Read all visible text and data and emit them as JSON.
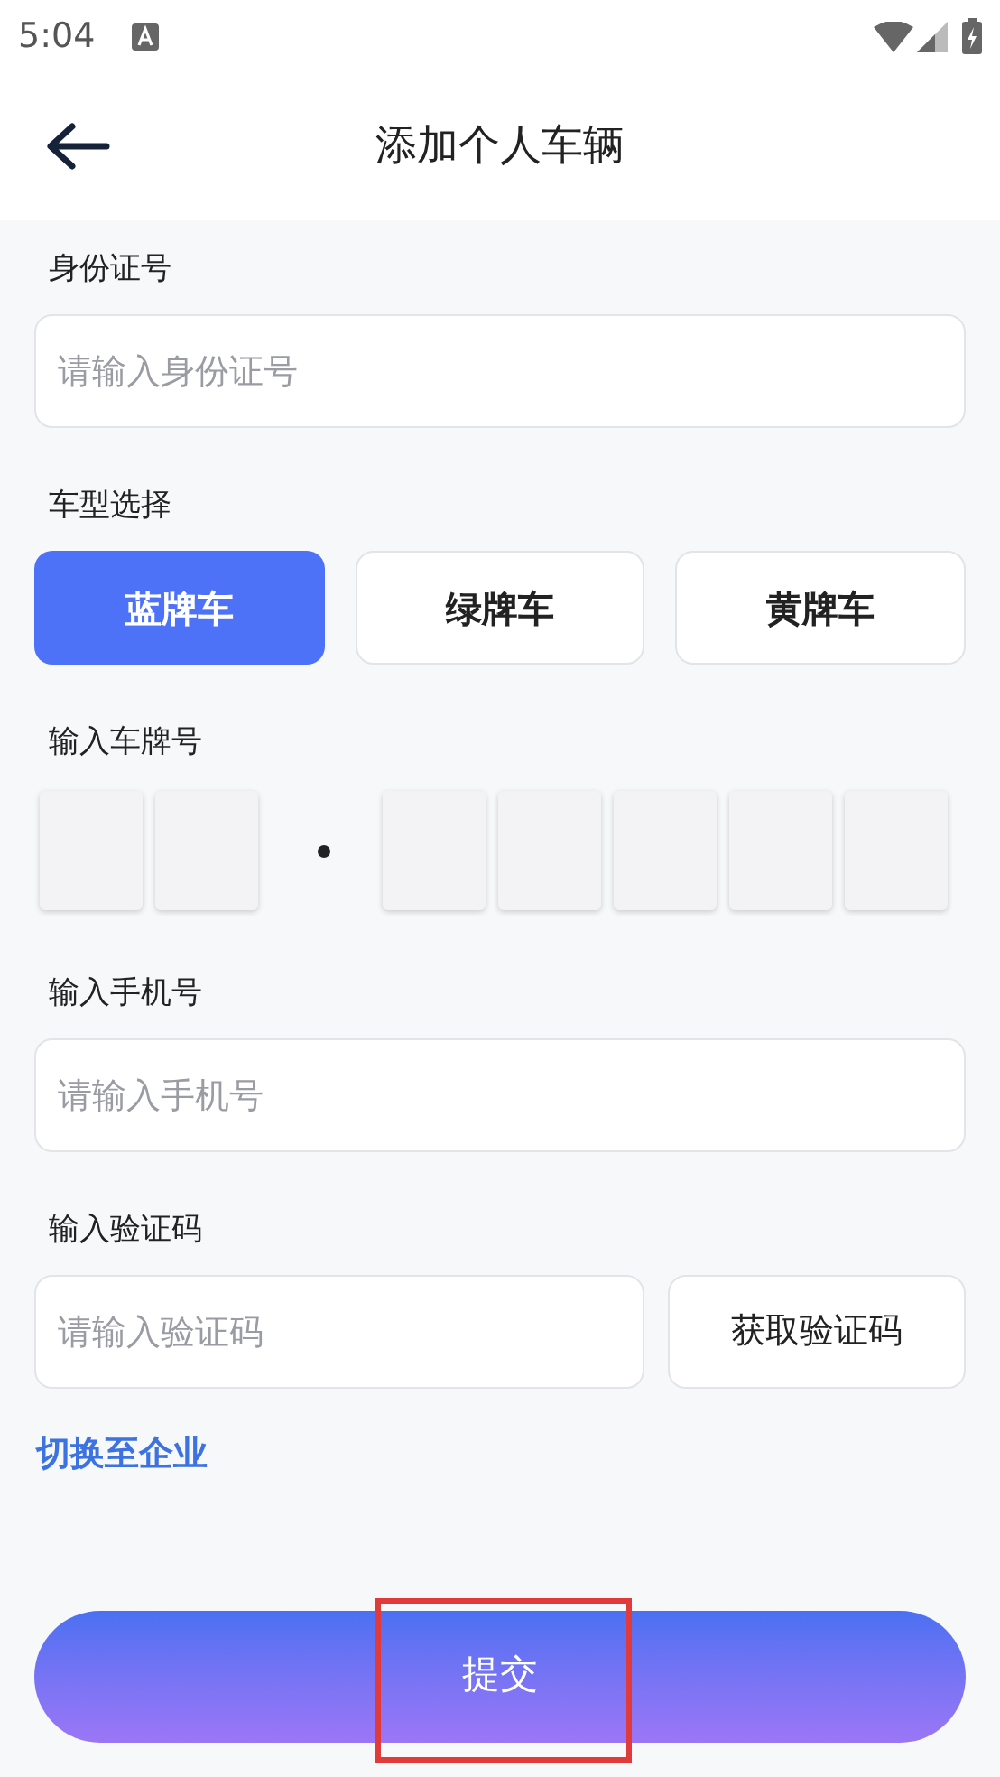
{
  "status_bar": {
    "time": "5:04"
  },
  "header": {
    "title": "添加个人车辆"
  },
  "id_field": {
    "label": "身份证号",
    "placeholder": "请输入身份证号"
  },
  "vehicle_type": {
    "label": "车型选择",
    "options": [
      {
        "label": "蓝牌车",
        "selected": true
      },
      {
        "label": "绿牌车",
        "selected": false
      },
      {
        "label": "黄牌车",
        "selected": false
      }
    ]
  },
  "plate": {
    "label": "输入车牌号"
  },
  "phone_field": {
    "label": "输入手机号",
    "placeholder": "请输入手机号"
  },
  "code_field": {
    "label": "输入验证码",
    "placeholder": "请输入验证码",
    "button": "获取验证码"
  },
  "switch_link": "切换至企业",
  "submit": {
    "label": "提交",
    "highlighted": true
  }
}
